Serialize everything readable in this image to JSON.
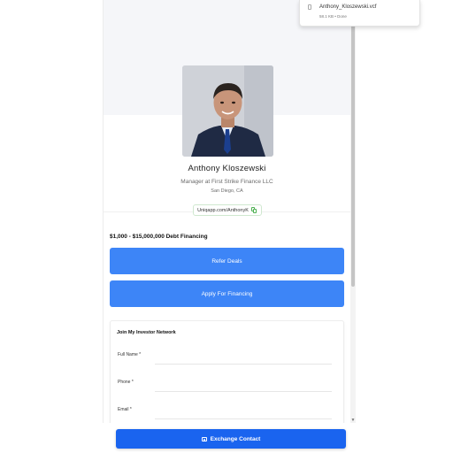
{
  "download": {
    "file_name": "Anthony_Kloszewski.vcf",
    "file_meta": "58.1 KB • Done"
  },
  "profile": {
    "name": "Anthony Kloszewski",
    "title": "Manager at First Strike Finance LLC",
    "location": "San Diego, CA",
    "url": "Uniqapp.com/AnthonyK"
  },
  "headline": "$1,000 - $15,000,000 Debt Financing",
  "buttons": {
    "refer": "Refer Deals",
    "finance": "Apply For Financing",
    "exchange": "Exchange Contact"
  },
  "form": {
    "title": "Join My Investor Network",
    "fields": [
      {
        "label": "Full Name *"
      },
      {
        "label": "Phone *"
      },
      {
        "label": "Email *"
      }
    ]
  },
  "colors": {
    "button_blue": "#3d85f7",
    "exchange_blue": "#1a64ef",
    "copy_green": "#4caf50"
  },
  "icons": [
    "file-icon",
    "copy-icon",
    "contact-card-icon",
    "scroll-down-arrow-icon"
  ]
}
